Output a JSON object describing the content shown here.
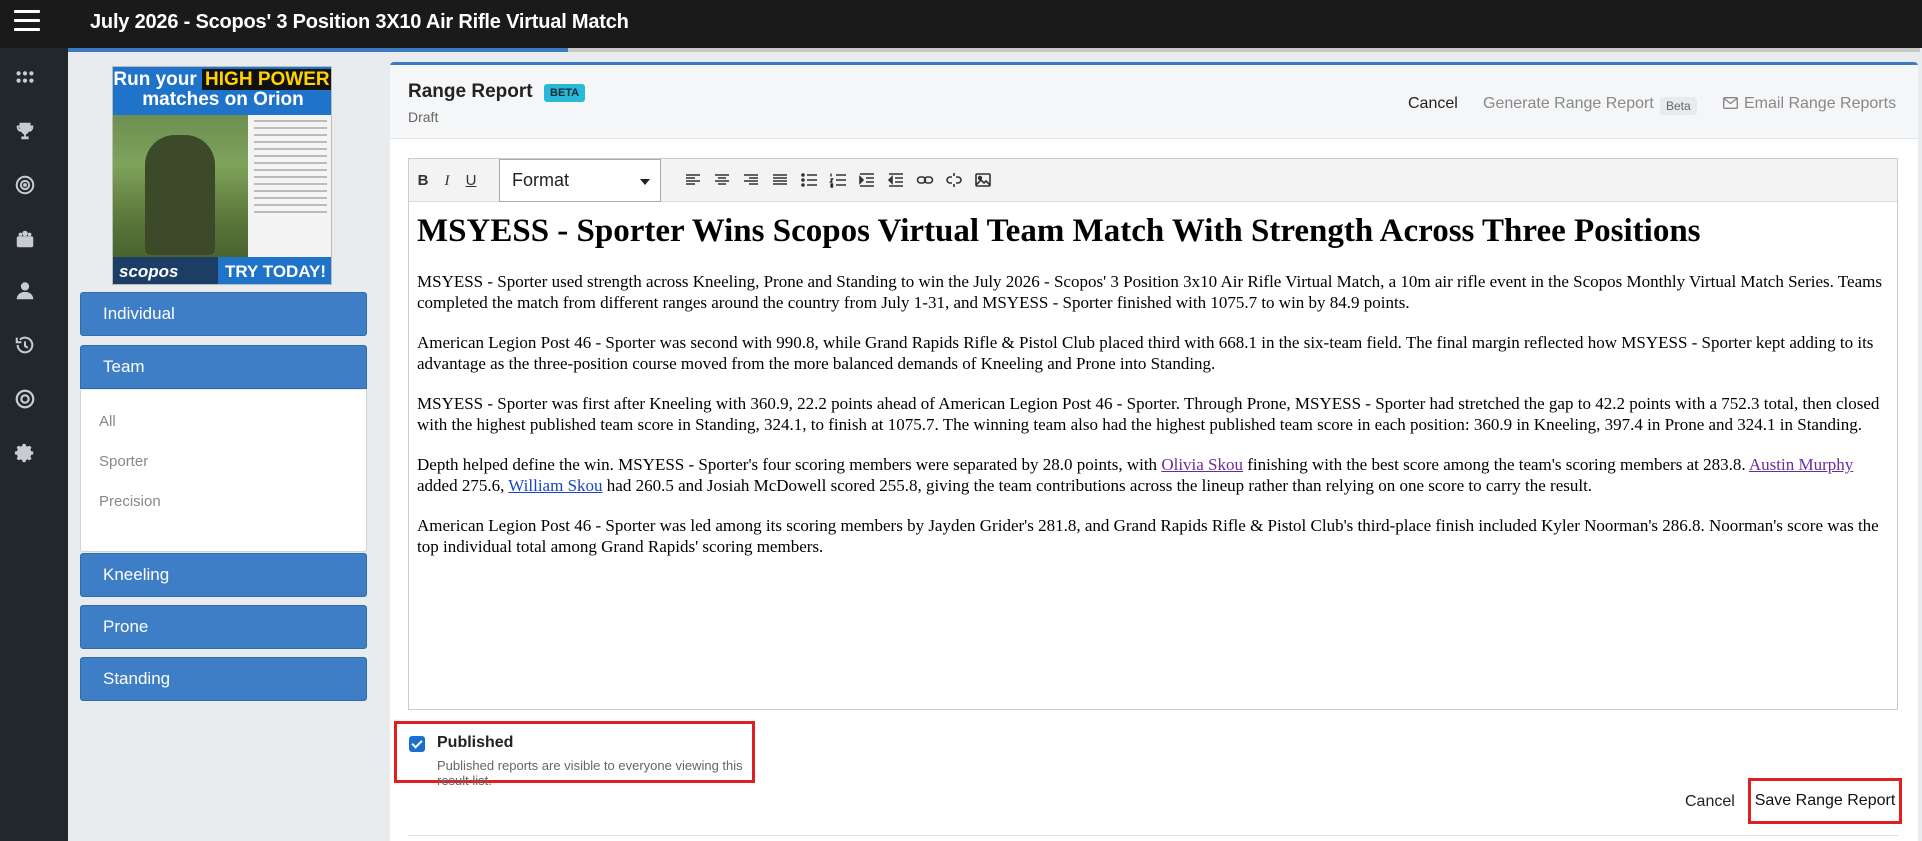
{
  "app": {
    "title": "July 2026 - Scopos' 3 Position 3X10 Air Rifle Virtual Match",
    "progress_fraction": 0.27
  },
  "rail": {
    "icons": [
      "apps-icon",
      "trophy-icon",
      "target-icon",
      "team-icon",
      "person-icon",
      "history-icon",
      "bullseye-icon",
      "gear-icon"
    ]
  },
  "ad": {
    "line1_a": "Run your ",
    "line1_b": "HIGH POWER",
    "line2": "matches on Orion",
    "logo": "scopos",
    "cta": "TRY TODAY!"
  },
  "nav": {
    "individual": "Individual",
    "team": "Team",
    "team_sub": [
      "All",
      "Sporter",
      "Precision"
    ],
    "kneeling": "Kneeling",
    "prone": "Prone",
    "standing": "Standing"
  },
  "header": {
    "title": "Range Report",
    "badge": "BETA",
    "status": "Draft",
    "cancel": "Cancel",
    "generate": "Generate Range Report",
    "generate_badge": "Beta",
    "email": "Email Range Reports"
  },
  "editor": {
    "format_label": "Format",
    "headline": "MSYESS - Sporter Wins Scopos Virtual Team Match With Strength Across Three Positions",
    "p1": "MSYESS - Sporter used strength across Kneeling, Prone and Standing to win the July 2026 - Scopos' 3 Position 3x10 Air Rifle Virtual Match, a 10m air rifle event in the Scopos Monthly Virtual Match Series. Teams completed the match from different ranges around the country from July 1-31, and MSYESS - Sporter finished with 1075.7 to win by 84.9 points.",
    "p2": "American Legion Post 46 - Sporter was second with 990.8, while Grand Rapids Rifle & Pistol Club placed third with 668.1 in the six-team field. The final margin reflected how MSYESS - Sporter kept adding to its advantage as the three-position course moved from the more balanced demands of Kneeling and Prone into Standing.",
    "p3": "MSYESS - Sporter was first after Kneeling with 360.9, 22.2 points ahead of American Legion Post 46 - Sporter. Through Prone, MSYESS - Sporter had stretched the gap to 42.2 points with a 752.3 total, then closed with the highest published team score in Standing, 324.1, to finish at 1075.7. The winning team also had the highest published team score in each position: 360.9 in Kneeling, 397.4 in Prone and 324.1 in Standing.",
    "p4_a": "Depth helped define the win. MSYESS - Sporter's four scoring members were separated by 28.0 points, with ",
    "p4_link1": "Olivia Skou",
    "p4_b": " finishing with the best score among the team's scoring members at 283.8. ",
    "p4_link2": "Austin Murphy",
    "p4_c": " added 275.6, ",
    "p4_link3": "William Skou",
    "p4_d": " had 260.5 and Josiah McDowell scored 255.8, giving the team contributions across the lineup rather than relying on one score to carry the result.",
    "p5": "American Legion Post 46 - Sporter was led among its scoring members by Jayden Grider's 281.8, and Grand Rapids Rifle & Pistol Club's third-place finish included Kyler Noorman's 286.8. Noorman's score was the top individual total among Grand Rapids' scoring members."
  },
  "publish": {
    "checked": true,
    "label": "Published",
    "help": "Published reports are visible to everyone viewing this result list."
  },
  "footer": {
    "cancel": "Cancel",
    "save": "Save Range Report"
  }
}
